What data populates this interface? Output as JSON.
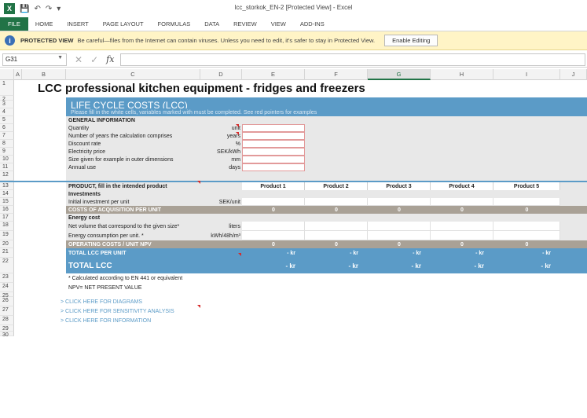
{
  "window": {
    "title": "lcc_storkok_EN-2 [Protected View] - Excel",
    "logo": "X"
  },
  "ribbon": {
    "tabs": [
      "FILE",
      "HOME",
      "INSERT",
      "PAGE LAYOUT",
      "FORMULAS",
      "DATA",
      "REVIEW",
      "VIEW",
      "ADD-INS"
    ]
  },
  "protected_bar": {
    "label": "PROTECTED VIEW",
    "message": "Be careful—files from the Internet can contain viruses. Unless you need to edit, it's safer to stay in Protected View.",
    "button": "Enable Editing"
  },
  "formula_bar": {
    "name_box": "G31",
    "fx": "fx",
    "value": ""
  },
  "columns": [
    "A",
    "B",
    "C",
    "D",
    "E",
    "F",
    "G",
    "H",
    "I",
    "J"
  ],
  "selected_column": "G",
  "sheet": {
    "title": "LCC professional kitchen equipment - fridges and freezers",
    "banner_title": "LIFE CYCLE COSTS (LCC)",
    "banner_subtitle": "Please fill in the white cells, variables marked with   must be completed. See red pointers for examples",
    "general_info": "GENERAL INFORMATION",
    "general_rows": [
      {
        "label": "Quantity",
        "unit": "unit"
      },
      {
        "label": "Number of years the calculation comprises",
        "unit": "years"
      },
      {
        "label": "Discount rate",
        "unit": "%"
      },
      {
        "label": "Electricity price",
        "unit": "SEK/kWh"
      },
      {
        "label": "Size given for example in outer dimensions",
        "unit": "mm"
      },
      {
        "label": "Annual use",
        "unit": "days"
      }
    ],
    "product_header": "PRODUCT, fill in the intended product",
    "products": [
      "Product 1",
      "Product 2",
      "Product 3",
      "Product 4",
      "Product 5"
    ],
    "investments": "Investments",
    "initial_investment": {
      "label": "Initial investment per unit",
      "unit": "SEK/unit"
    },
    "costs_acq": "COSTS OF ACQUISITION PER UNIT",
    "costs_acq_values": [
      "0",
      "0",
      "0",
      "0",
      "0"
    ],
    "energy_cost": "Energy cost",
    "net_volume": {
      "label": "Net volume that correspond to the given size*",
      "unit": "liters"
    },
    "energy_consumption": {
      "label": "Energy consumption per unit. *",
      "unit": "kWh/48h/m³"
    },
    "operating": "OPERATING  COSTS / UNIT NPV",
    "operating_values": [
      "0",
      "0",
      "0",
      "0",
      "0"
    ],
    "total_lcc_unit": "TOTAL LCC PER UNIT",
    "total_lcc_unit_values": [
      "- kr",
      "- kr",
      "- kr",
      "- kr",
      "- kr"
    ],
    "total_lcc": "TOTAL LCC",
    "total_lcc_values": [
      "- kr",
      "- kr",
      "- kr",
      "- kr",
      "- kr"
    ],
    "footnote1": "* Calculated according to EN 441 or equivalent",
    "footnote2": "NPV= NET PRESENT VALUE",
    "links": [
      "> CLICK HERE FOR DIAGRAMS",
      "> CLICK HERE FOR SENSITIVITY ANALYSIS",
      "> CLICK HERE FOR INFORMATION"
    ]
  },
  "row_numbers": [
    "1",
    "2",
    "3",
    "4",
    "5",
    "6",
    "7",
    "8",
    "9",
    "10",
    "11",
    "12",
    "13",
    "14",
    "15",
    "16",
    "17",
    "18",
    "19",
    "20",
    "21",
    "22",
    "23",
    "24",
    "25",
    "26",
    "27",
    "28",
    "29",
    "30"
  ],
  "colors": {
    "excel_green": "#217346",
    "banner_blue": "#5b9bc7",
    "tan": "#a9a196",
    "protected_yellow": "#fff4c6",
    "required_red": "#d62b2b"
  }
}
